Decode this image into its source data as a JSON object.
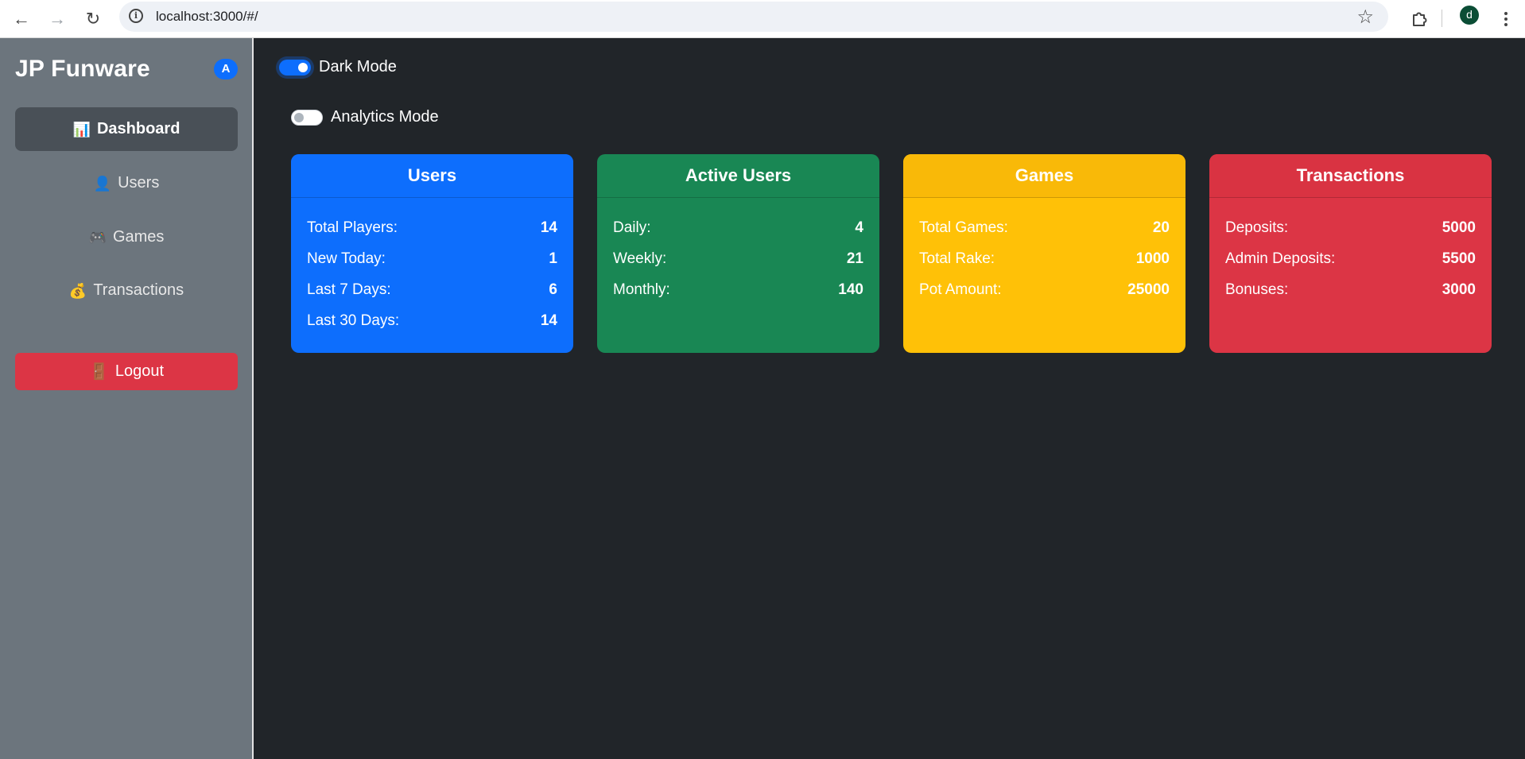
{
  "browser": {
    "url": "localhost:3000/#/",
    "profile_initial": "d",
    "info_icon": "i",
    "icons": {
      "back": "←",
      "forward": "→",
      "reload": "↻",
      "star": "☆"
    }
  },
  "sidebar": {
    "brand": "JP Funware",
    "badge": "A",
    "items": [
      {
        "icon": "📊",
        "label": "Dashboard",
        "active": true
      },
      {
        "icon": "👤",
        "label": "Users",
        "active": false
      },
      {
        "icon": "🎮",
        "label": "Games",
        "active": false
      },
      {
        "icon": "💰",
        "label": "Transactions",
        "active": false
      }
    ],
    "logout": {
      "icon": "🚪",
      "label": "Logout"
    }
  },
  "toggles": {
    "dark_mode": {
      "label": "Dark Mode",
      "on": true
    },
    "analytics_mode": {
      "label": "Analytics Mode",
      "on": false
    }
  },
  "cards": [
    {
      "title": "Users",
      "color": "#0d6efd",
      "rows": [
        {
          "label": "Total Players:",
          "value": "14"
        },
        {
          "label": "New Today:",
          "value": "1"
        },
        {
          "label": "Last 7 Days:",
          "value": "6"
        },
        {
          "label": "Last 30 Days:",
          "value": "14"
        }
      ]
    },
    {
      "title": "Active Users",
      "color": "#198754",
      "rows": [
        {
          "label": "Daily:",
          "value": "4"
        },
        {
          "label": "Weekly:",
          "value": "21"
        },
        {
          "label": "Monthly:",
          "value": "140"
        }
      ]
    },
    {
      "title": "Games",
      "color": "#ffc107",
      "rows": [
        {
          "label": "Total Games:",
          "value": "20"
        },
        {
          "label": "Total Rake:",
          "value": "1000"
        },
        {
          "label": "Pot Amount:",
          "value": "25000"
        }
      ]
    },
    {
      "title": "Transactions",
      "color": "#dc3545",
      "rows": [
        {
          "label": "Deposits:",
          "value": "5000"
        },
        {
          "label": "Admin Deposits:",
          "value": "5500"
        },
        {
          "label": "Bonuses:",
          "value": "3000"
        }
      ]
    }
  ]
}
